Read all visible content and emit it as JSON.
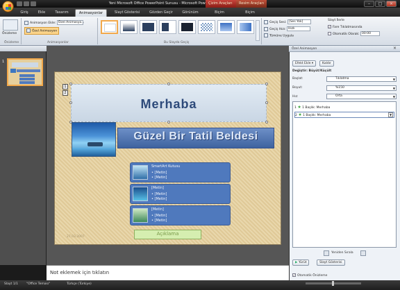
{
  "window": {
    "title": "Yeni Microsoft Office PowerPoint Sunusu - Microsoft PowerPoint",
    "contextual_tabs": [
      "Çizim Araçları",
      "Resim Araçları"
    ]
  },
  "tabs": [
    "Giriş",
    "Ekle",
    "Tasarım",
    "Animasyonlar",
    "Slayt Gösterisi",
    "Gözden Geçir",
    "Görünüm",
    "Biçim",
    "Biçim"
  ],
  "ribbon": {
    "preview_label": "Önizleme",
    "animate_label": "Animasyon Ekle:",
    "animate_value": "Özel Animasyo...",
    "custom_anim_label": "Özel Animasyon",
    "group_preview": "Önizleme",
    "group_animations": "Animasyonlar",
    "group_transition": "Bu Slayda Geçiş",
    "sound_label": "Geçiş Sesi:",
    "sound_value": "[Ses Yok]",
    "speed_label": "Geçiş Hızı:",
    "speed_value": "Hızlı",
    "apply_all": "Tümüne Uygula",
    "advance_label": "Slayt İlerle",
    "on_click_label": "Fare Tıklatmasında",
    "auto_label": "Otomatik Olarak:",
    "auto_value": "00:00"
  },
  "slide": {
    "number": "1",
    "title": "Merhaba",
    "subtitle": "Güzel Bir Tatil Beldesi",
    "anim_tags": [
      "1",
      "2"
    ],
    "smartart": [
      {
        "head": "SmartArt Kutusu",
        "lines": [
          "• [Metin]",
          "• [Metin]"
        ]
      },
      {
        "head": "[Metin]",
        "lines": [
          "• [Metin]",
          "• [Metin]"
        ]
      },
      {
        "head": "[Metin]",
        "lines": [
          "• [Metin]",
          "• [Metin]"
        ]
      }
    ],
    "caption": "Açıklama",
    "date": "27.03.2007"
  },
  "notes": {
    "text": "Not eklemek için tıklatın"
  },
  "taskpane": {
    "title": "Özel Animasyon",
    "add_effect": "Efekt Ekle",
    "remove": "Kaldır",
    "modify_label": "Değiştir: Büyüt/Küçült",
    "start_label": "Başlat:",
    "start_value": "Tıklatma",
    "size_label": "Boyut:",
    "size_value": "%150",
    "speed_label": "Hız:",
    "speed_value": "Orta",
    "items": [
      {
        "num": "1",
        "label": "1 Başlık: Merhaba"
      },
      {
        "num": "2",
        "label": "1 Başlık: Merhaba"
      }
    ],
    "reorder_label": "Yeniden Sırala",
    "play_label": "Yürüt",
    "slideshow_label": "Slayt Gösterisi",
    "autopreview_label": "Otomatik Önizleme"
  },
  "status": {
    "slide": "Slayt 1/1",
    "theme": "\"Office Teması\"",
    "language": "Türkçe (Türkiye)"
  }
}
